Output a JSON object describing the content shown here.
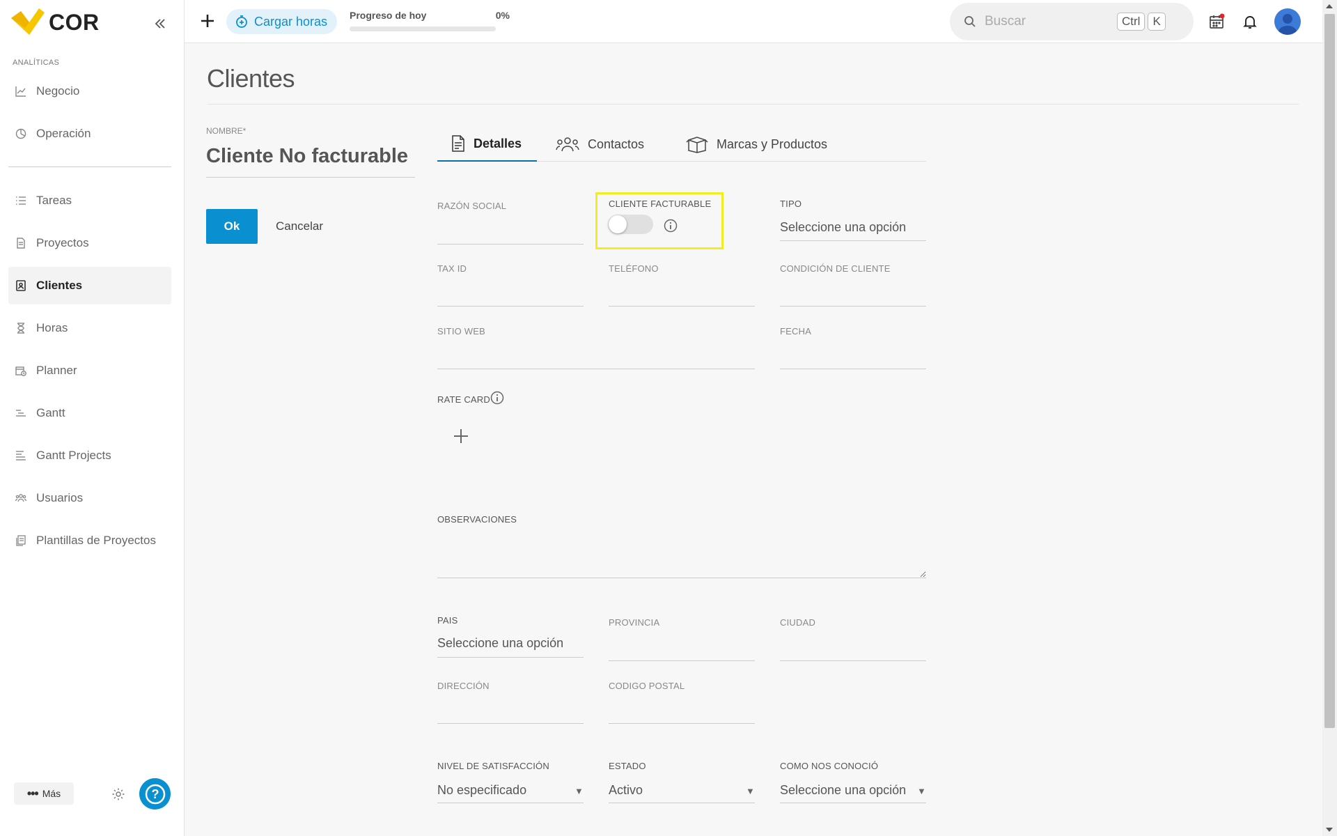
{
  "brand": {
    "name": "COR",
    "accent": "#0a8fd0",
    "logo_yellow": "#f6c700"
  },
  "sidebar": {
    "section_label": "ANALÍTICAS",
    "items": [
      {
        "label": "Negocio",
        "icon": "chart-line-icon"
      },
      {
        "label": "Operación",
        "icon": "pie-chart-icon"
      },
      {
        "label": "Tareas",
        "icon": "task-list-icon"
      },
      {
        "label": "Proyectos",
        "icon": "document-icon"
      },
      {
        "label": "Clientes",
        "icon": "contact-book-icon",
        "active": true
      },
      {
        "label": "Horas",
        "icon": "hourglass-icon"
      },
      {
        "label": "Planner",
        "icon": "calendar-clock-icon"
      },
      {
        "label": "Gantt",
        "icon": "gantt-icon"
      },
      {
        "label": "Gantt Projects",
        "icon": "gantt-lines-icon"
      },
      {
        "label": "Usuarios",
        "icon": "users-icon"
      },
      {
        "label": "Plantillas de Proyectos",
        "icon": "templates-icon"
      }
    ],
    "more_label": "Más"
  },
  "topbar": {
    "cargar_horas": "Cargar horas",
    "progress_label": "Progreso de hoy",
    "progress_value": "0%",
    "progress_fraction": 0,
    "search_placeholder": "Buscar",
    "kbd_ctrl": "Ctrl",
    "kbd_k": "K"
  },
  "page": {
    "title": "Clientes"
  },
  "form": {
    "name_label": "NOMBRE*",
    "name_value": "Cliente No facturable",
    "ok_label": "Ok",
    "cancel_label": "Cancelar",
    "tabs": [
      {
        "label": "Detalles",
        "icon": "document-icon",
        "active": true
      },
      {
        "label": "Contactos",
        "icon": "users-icon"
      },
      {
        "label": "Marcas y Productos",
        "icon": "box-icon"
      }
    ],
    "razon_social": "RAZÓN SOCIAL",
    "cliente_facturable": "CLIENTE FACTURABLE",
    "cliente_facturable_on": false,
    "tipo": "TIPO",
    "tipo_value": "Seleccione una opción",
    "tax_id": "TAX ID",
    "telefono": "TELÉFONO",
    "condicion": "CONDICIÓN DE CLIENTE",
    "sitio_web": "SITIO WEB",
    "fecha": "FECHA",
    "rate_card": "RATE CARD",
    "observaciones": "OBSERVACIONES",
    "pais": "PAIS",
    "pais_value": "Seleccione una opción",
    "provincia": "PROVINCIA",
    "ciudad": "CIUDAD",
    "direccion": "DIRECCIÓN",
    "codigo_postal": "CODIGO POSTAL",
    "nivel": "NIVEL DE SATISFACCIÓN",
    "nivel_value": "No especificado",
    "estado": "ESTADO",
    "estado_value": "Activo",
    "como": "COMO NOS CONOCIÓ",
    "como_value": "Seleccione una opción"
  }
}
